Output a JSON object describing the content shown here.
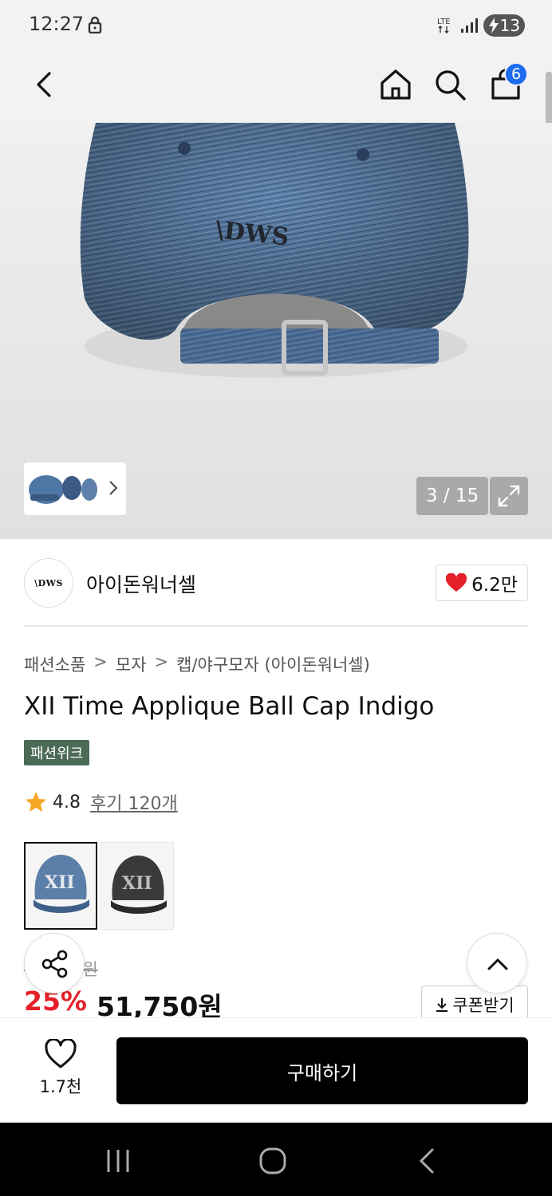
{
  "status_bar": {
    "time": "12:27",
    "battery_level": "13",
    "network": "LTE"
  },
  "header": {
    "cart_count": "6",
    "icons": [
      "back-icon",
      "home-icon",
      "search-icon",
      "shopping-bag-icon"
    ]
  },
  "gallery": {
    "counter": "3 / 15"
  },
  "brand": {
    "logo_text": "\\DWS",
    "name": "아이돈워너셀",
    "like_count": "6.2만"
  },
  "breadcrumb": {
    "items": [
      "패션소품",
      "모자",
      "캡/야구모자 (아이돈워너셀)"
    ],
    "separator": ">"
  },
  "product": {
    "title": "XII Time Applique Ball Cap Indigo",
    "tag": "패션위크",
    "rating": "4.8",
    "review_link": "후기 120개",
    "original_price": "69,000원",
    "discount": "25%",
    "price": "51,750원",
    "coupon_label": "쿠폰받기"
  },
  "buy_bar": {
    "wish_count": "1.7천",
    "buy_label": "구매하기"
  },
  "colors": {
    "accent_blue": "#1d6cf0",
    "discount_red": "#e5202a",
    "tag_green": "#4b6b57",
    "buy_black": "#000000"
  }
}
